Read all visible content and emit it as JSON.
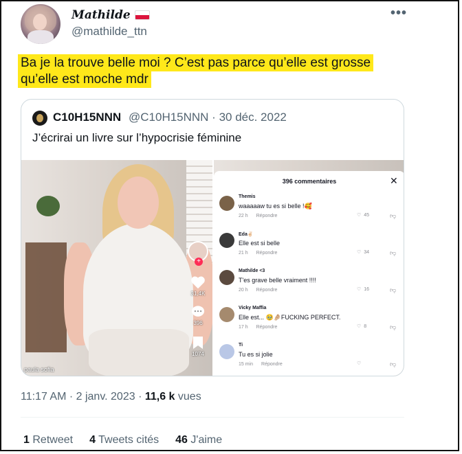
{
  "author": {
    "display_name": "Mathilde",
    "handle": "@mathilde_ttn"
  },
  "tweet_text": "Ba je la trouve belle moi ? C’est pas parce qu’elle est grosse qu’elle est moche mdr",
  "highlight_color": "#ffe81a",
  "quoted": {
    "display_name": "C10H15NNN",
    "handle_date": "@C10H15NNN · 30 déc. 2022",
    "text": "J’écrirai un livre sur l’hypocrisie féminine"
  },
  "video_overlay": {
    "likes": "31,4K",
    "comments_count": "396",
    "saves": "1074",
    "watermark": "paula sofia"
  },
  "comments_panel": {
    "title": "396 commentaires",
    "reply_label": "Répondre",
    "items": [
      {
        "name": "Themis",
        "text": "waaaaaw tu es si belle !🥰",
        "time": "22 h",
        "likes": "45",
        "avatar_color": "#7a6248"
      },
      {
        "name": "Eda✌🏻",
        "text": "Elle est si belle",
        "time": "21 h",
        "likes": "34",
        "avatar_color": "#3a3a3a"
      },
      {
        "name": "Mathilde <3",
        "text": "T'es grave belle vraiment !!!!",
        "time": "20 h",
        "likes": "16",
        "avatar_color": "#5b4a3f"
      },
      {
        "name": "Vicky Maffia",
        "text": "Elle est... 🥹🤌🏼FUCKING PERFECT.",
        "time": "17 h",
        "likes": "8",
        "avatar_color": "#a58a6e"
      },
      {
        "name": "Ti",
        "text": "Tu es si jolie",
        "time": "15 min",
        "likes": "",
        "avatar_color": "#b9c7e6"
      }
    ]
  },
  "timestamp": {
    "time_date": "11:17 AM · 2 janv. 2023 · ",
    "views": "11,6 k",
    "views_label": " vues"
  },
  "stats": {
    "retweets": "1",
    "retweets_label": "Retweet",
    "quotes": "4",
    "quotes_label": "Tweets cités",
    "likes": "46",
    "likes_label": "J'aime"
  }
}
